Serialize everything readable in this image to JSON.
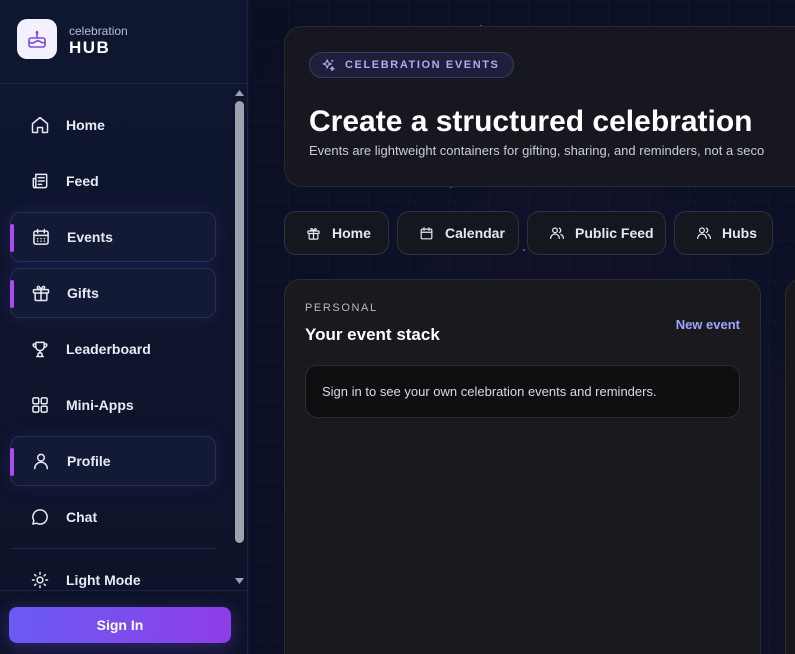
{
  "brand": {
    "small": "celebration",
    "big": "HUB"
  },
  "nav": [
    {
      "label": "Home",
      "icon": "home-icon",
      "active": false
    },
    {
      "label": "Feed",
      "icon": "newspaper-icon",
      "active": false
    },
    {
      "label": "Events",
      "icon": "calendar-icon",
      "active": true
    },
    {
      "label": "Gifts",
      "icon": "gift-icon",
      "active": true
    },
    {
      "label": "Leaderboard",
      "icon": "trophy-icon",
      "active": false
    },
    {
      "label": "Mini-Apps",
      "icon": "grid-icon",
      "active": false
    },
    {
      "label": "Profile",
      "icon": "user-icon",
      "active": true
    },
    {
      "label": "Chat",
      "icon": "chat-bubble-icon",
      "active": false
    },
    {
      "label": "Light Mode",
      "icon": "sun-icon",
      "active": false
    }
  ],
  "signin": {
    "label": "Sign In"
  },
  "hero": {
    "badge": "CELEBRATION EVENTS",
    "title": "Create a structured celebration",
    "subtitle": "Events are lightweight containers for gifting, sharing, and reminders, not a seco"
  },
  "quick_links": [
    {
      "label": "Home",
      "icon": "gift-icon"
    },
    {
      "label": "Calendar",
      "icon": "calendar-icon"
    },
    {
      "label": "Public Feed",
      "icon": "users-icon"
    },
    {
      "label": "Hubs",
      "icon": "users-icon"
    }
  ],
  "panel": {
    "eyebrow": "PERSONAL",
    "title": "Your event stack",
    "link": "New event",
    "empty_message": "Sign in to see your own celebration events and reminders."
  },
  "colors": {
    "accent": "#a64df0",
    "signin_gradient_start": "#6a5bf6",
    "signin_gradient_end": "#8e3ee6",
    "link": "#9ea6ff",
    "background": "#0b0f23"
  }
}
